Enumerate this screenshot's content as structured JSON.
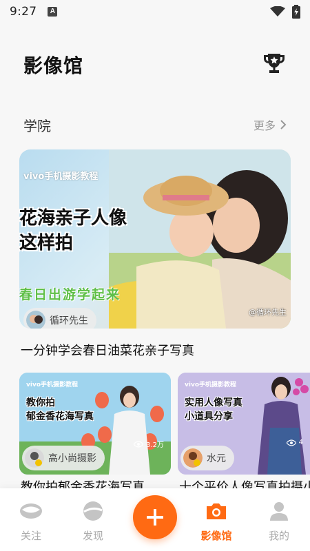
{
  "status_bar": {
    "time": "9:27",
    "notif_letter": "A"
  },
  "header": {
    "title": "影像馆"
  },
  "section": {
    "title": "学院",
    "more_label": "更多"
  },
  "hero": {
    "tag": "vivo手机摄影教程",
    "headline_line1": "花海亲子人像",
    "headline_line2": "这样拍",
    "subheadline": "春日出游学起来",
    "credit": "@循环先生",
    "author": "循环先生",
    "caption": "一分钟学会春日油菜花亲子写真"
  },
  "cards": [
    {
      "tag": "vivo手机摄影教程",
      "headline_line1": "教你拍",
      "headline_line2": "郁金香花海写真",
      "views": "3.2万",
      "author": "高小尚摄影",
      "caption": "教你拍郁金香花海写真"
    },
    {
      "tag": "vivo手机摄影教程",
      "headline_line1": "实用人像写真",
      "headline_line2": "小道具分享",
      "views": "4",
      "author": "水元",
      "caption": "十个平价人像写真拍摄小"
    }
  ],
  "tabbar": {
    "tabs": [
      {
        "label": "关注",
        "icon": "follow-icon"
      },
      {
        "label": "发现",
        "icon": "discover-icon"
      },
      {
        "label": "影像馆",
        "icon": "camera-icon",
        "active": true
      },
      {
        "label": "我的",
        "icon": "profile-icon"
      }
    ],
    "fab_icon": "plus-icon"
  },
  "colors": {
    "accent": "#ff6a13",
    "background": "#f7f7f7",
    "muted": "#aaaaaa"
  }
}
